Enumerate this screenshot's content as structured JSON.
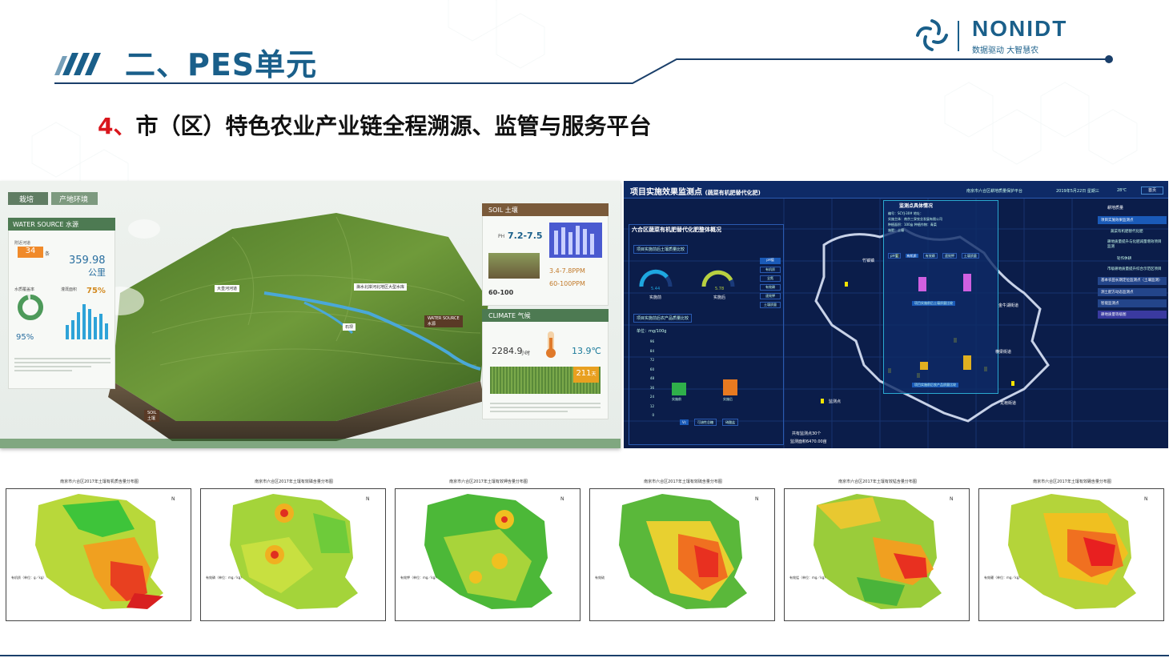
{
  "header": {
    "title": "二、PES单元",
    "subtitle_num": "4、",
    "subtitle_text": "市（区）特色农业产业链全程溯源、监管与服务平台"
  },
  "logo": {
    "name": "NONIDT",
    "tagline": "数据驱动  大智慧农"
  },
  "left_panel": {
    "tabs": [
      "栽培",
      "产地环境"
    ],
    "water_title": "WATER SOURCE 水源",
    "water_dist_label": "附近河道",
    "water_dist_value": "34",
    "water_dist_unit": "条",
    "water_length_value": "359.98",
    "water_length_unit": "公里",
    "water_quality_label": "水质覆盖率",
    "water_quality_value": "95%",
    "water_rate_label": "灌溉面积",
    "water_rate_value": "75%",
    "map_labels": [
      "大皇河河道",
      "滁水北岸河北地区大型水库",
      "石坝",
      "WATER SOURCE",
      "水源",
      "SOIL",
      "土壤"
    ],
    "soil_title": "SOIL 土壤",
    "soil_ph_label": "PH",
    "soil_ph_value": "7.2-7.5",
    "soil_ppm1": "3.4-7.8PPM",
    "soil_ppm2": "60-100PPM",
    "soil_cm": "60-100",
    "climate_title": "CLIMATE 气候",
    "climate_hours": "2284.9",
    "climate_hours_unit": "小时",
    "climate_temp": "13.9℃",
    "climate_days": "211",
    "climate_days_unit": "天"
  },
  "right_panel": {
    "title": "项目实施效果监测点",
    "title_sub": "(蔬菜有机肥替代化肥)",
    "org": "南京市六合区耕地质量保护平台",
    "date": "2019年5月22日 星期三",
    "temp": "28℃",
    "back": "首页",
    "overview_title": "六合区蔬菜有机肥替代化肥整体概况",
    "compare1_title": "项目实施前后土壤质量比较",
    "gauge1_value": "5.44",
    "gauge1_label": "实施前",
    "gauge2_value": "5.78",
    "gauge2_label": "实施后",
    "tags": [
      "pH值",
      "有机质",
      "全氮",
      "有效磷",
      "速效钾",
      "土壤质量"
    ],
    "compare2_title": "项目实施前后农产品质量比较",
    "unit": "单位：mg/100g",
    "bar_ticks": [
      "96",
      "84",
      "72",
      "60",
      "48",
      "36",
      "24",
      "12",
      "0"
    ],
    "bar_labels": [
      "实施前",
      "实施后"
    ],
    "bottom_btns": [
      "Vc",
      "可溶性总糖",
      "硝酸盐"
    ],
    "detail_title": "监测点具体情况",
    "detail_lines": [
      "编号：SCYJ-30#  地址：",
      "实施主体：南京三泉农业发展有限公司",
      "种植面积：100亩  种植作物：青菜",
      "施肥：土壤"
    ],
    "detail_tabs": [
      "pH值",
      "有机质",
      "有效磷",
      "速效钾",
      "土壤质量"
    ],
    "detail_chart_title": "项目实施前后土壤质量比较",
    "detail_chart2_title": "项目实施前后农产品质量比较",
    "count": "共有监测点30个",
    "area": "监测面积6470.00亩",
    "town_labels": [
      "竹镇镇",
      "金牛湖街道",
      "横梁街道",
      "龙袍街道",
      "监测点"
    ],
    "menu_header": "耕地质量",
    "menu": [
      "项目实施效果监测点",
      "蔬菜有机肥替代化肥",
      "耕地质量提升与化肥减量增效项目监测",
      "轮作休耕",
      "市级耕地质量提升综合示范区项目",
      "基本农田长期定位监测点（土壤监测）",
      "测土配方动态监测点",
      "智能监测点",
      "耕地质量等级图"
    ]
  },
  "maps": {
    "titles": [
      "南京市六合区2017年土壤有机质含量分布图",
      "南京市六合区2017年土壤有效磷含量分布图",
      "南京市六合区2017年土壤有效钾含量分布图",
      "南京市六合区2017年土壤有效硫含量分布图",
      "南京市六合区2017年土壤有效锰含量分布图",
      "南京市六合区2017年土壤有效硼含量分布图"
    ],
    "legends": [
      "有机质（单位：g／kg）",
      "有效磷（单位：mg／kg）",
      "有效钾（单位：mg／kg）",
      "有效硫",
      "有效锰（单位：mg／kg）",
      "有效硼（单位：mg／kg）"
    ]
  },
  "colors": {
    "brand": "#1a5f8a",
    "accent_red": "#d9161c"
  }
}
